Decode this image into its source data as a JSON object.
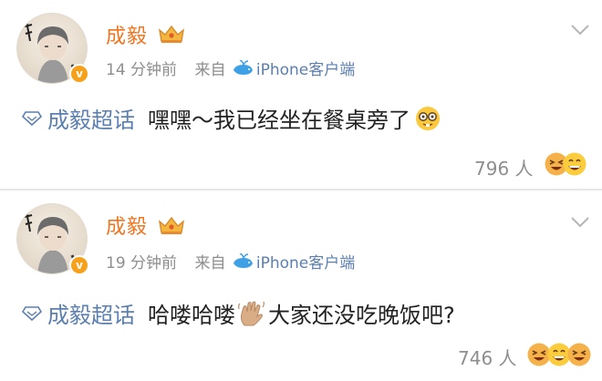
{
  "posts": [
    {
      "username": "成毅",
      "time": "14 分钟前",
      "source_prefix": "来自",
      "source_name": "iPhone客户端",
      "topic": "成毅超话",
      "text": "嘿嘿～我已经坐在餐桌旁了",
      "likes": "796",
      "likes_unit": "人"
    },
    {
      "username": "成毅",
      "time": "19 分钟前",
      "source_prefix": "来自",
      "source_name": "iPhone客户端",
      "topic": "成毅超话",
      "text_before": "哈喽哈喽",
      "text_after": "大家还没吃晚饭吧?",
      "likes": "746",
      "likes_unit": "人"
    }
  ],
  "badge_letter": "v",
  "colors": {
    "username": "#f0751f",
    "link": "#5b7fb1",
    "meta": "#8e8e8e",
    "verified": "#f7a11a"
  },
  "icons": [
    "avatar",
    "verified-badge-icon",
    "crown-badge-icon",
    "whale-icon",
    "chevron-down-icon",
    "topic-diamond-icon",
    "nerd-face-emoji",
    "waving-hand-emoji",
    "laughing-face-icon",
    "grinning-face-icon"
  ]
}
